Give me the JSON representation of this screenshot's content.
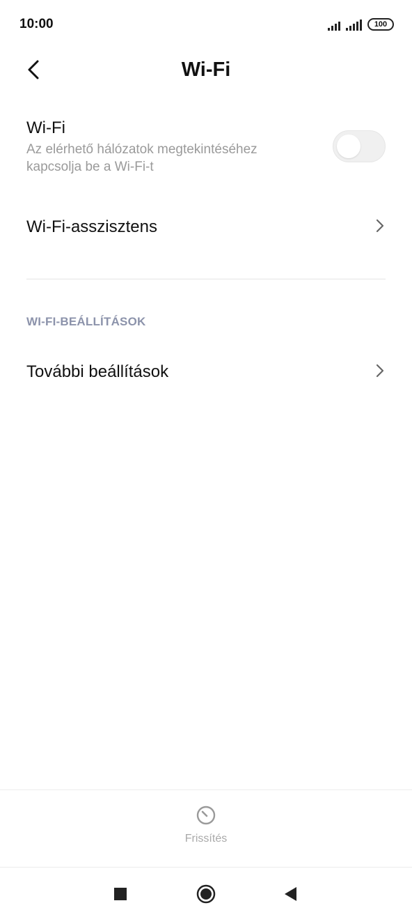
{
  "status_bar": {
    "time": "10:00",
    "battery": "100",
    "icons": [
      "signal-icon",
      "signal-icon",
      "battery-icon"
    ]
  },
  "header": {
    "title": "Wi-Fi",
    "back_icon": "chevron-left-icon"
  },
  "wifi": {
    "title": "Wi-Fi",
    "subtitle": "Az elérhető hálózatok megtekintéséhez kapcsolja be a Wi-Fi-t",
    "enabled": false
  },
  "assistant": {
    "title": "Wi-Fi-asszisztens",
    "icon": "chevron-right-icon"
  },
  "section": {
    "header": "WI-FI-BEÁLLÍTÁSOK"
  },
  "more_settings": {
    "title": "További beállítások",
    "icon": "chevron-right-icon"
  },
  "bottom_bar": {
    "refresh_label": "Frissítés",
    "refresh_icon": "refresh-icon"
  },
  "nav_bar": {
    "icons": [
      "recents-icon",
      "home-icon",
      "back-icon"
    ]
  },
  "colors": {
    "section_header": "#8c93ab",
    "secondary_text": "#9a9a9a",
    "toggle_off": "#f0f0f0"
  }
}
